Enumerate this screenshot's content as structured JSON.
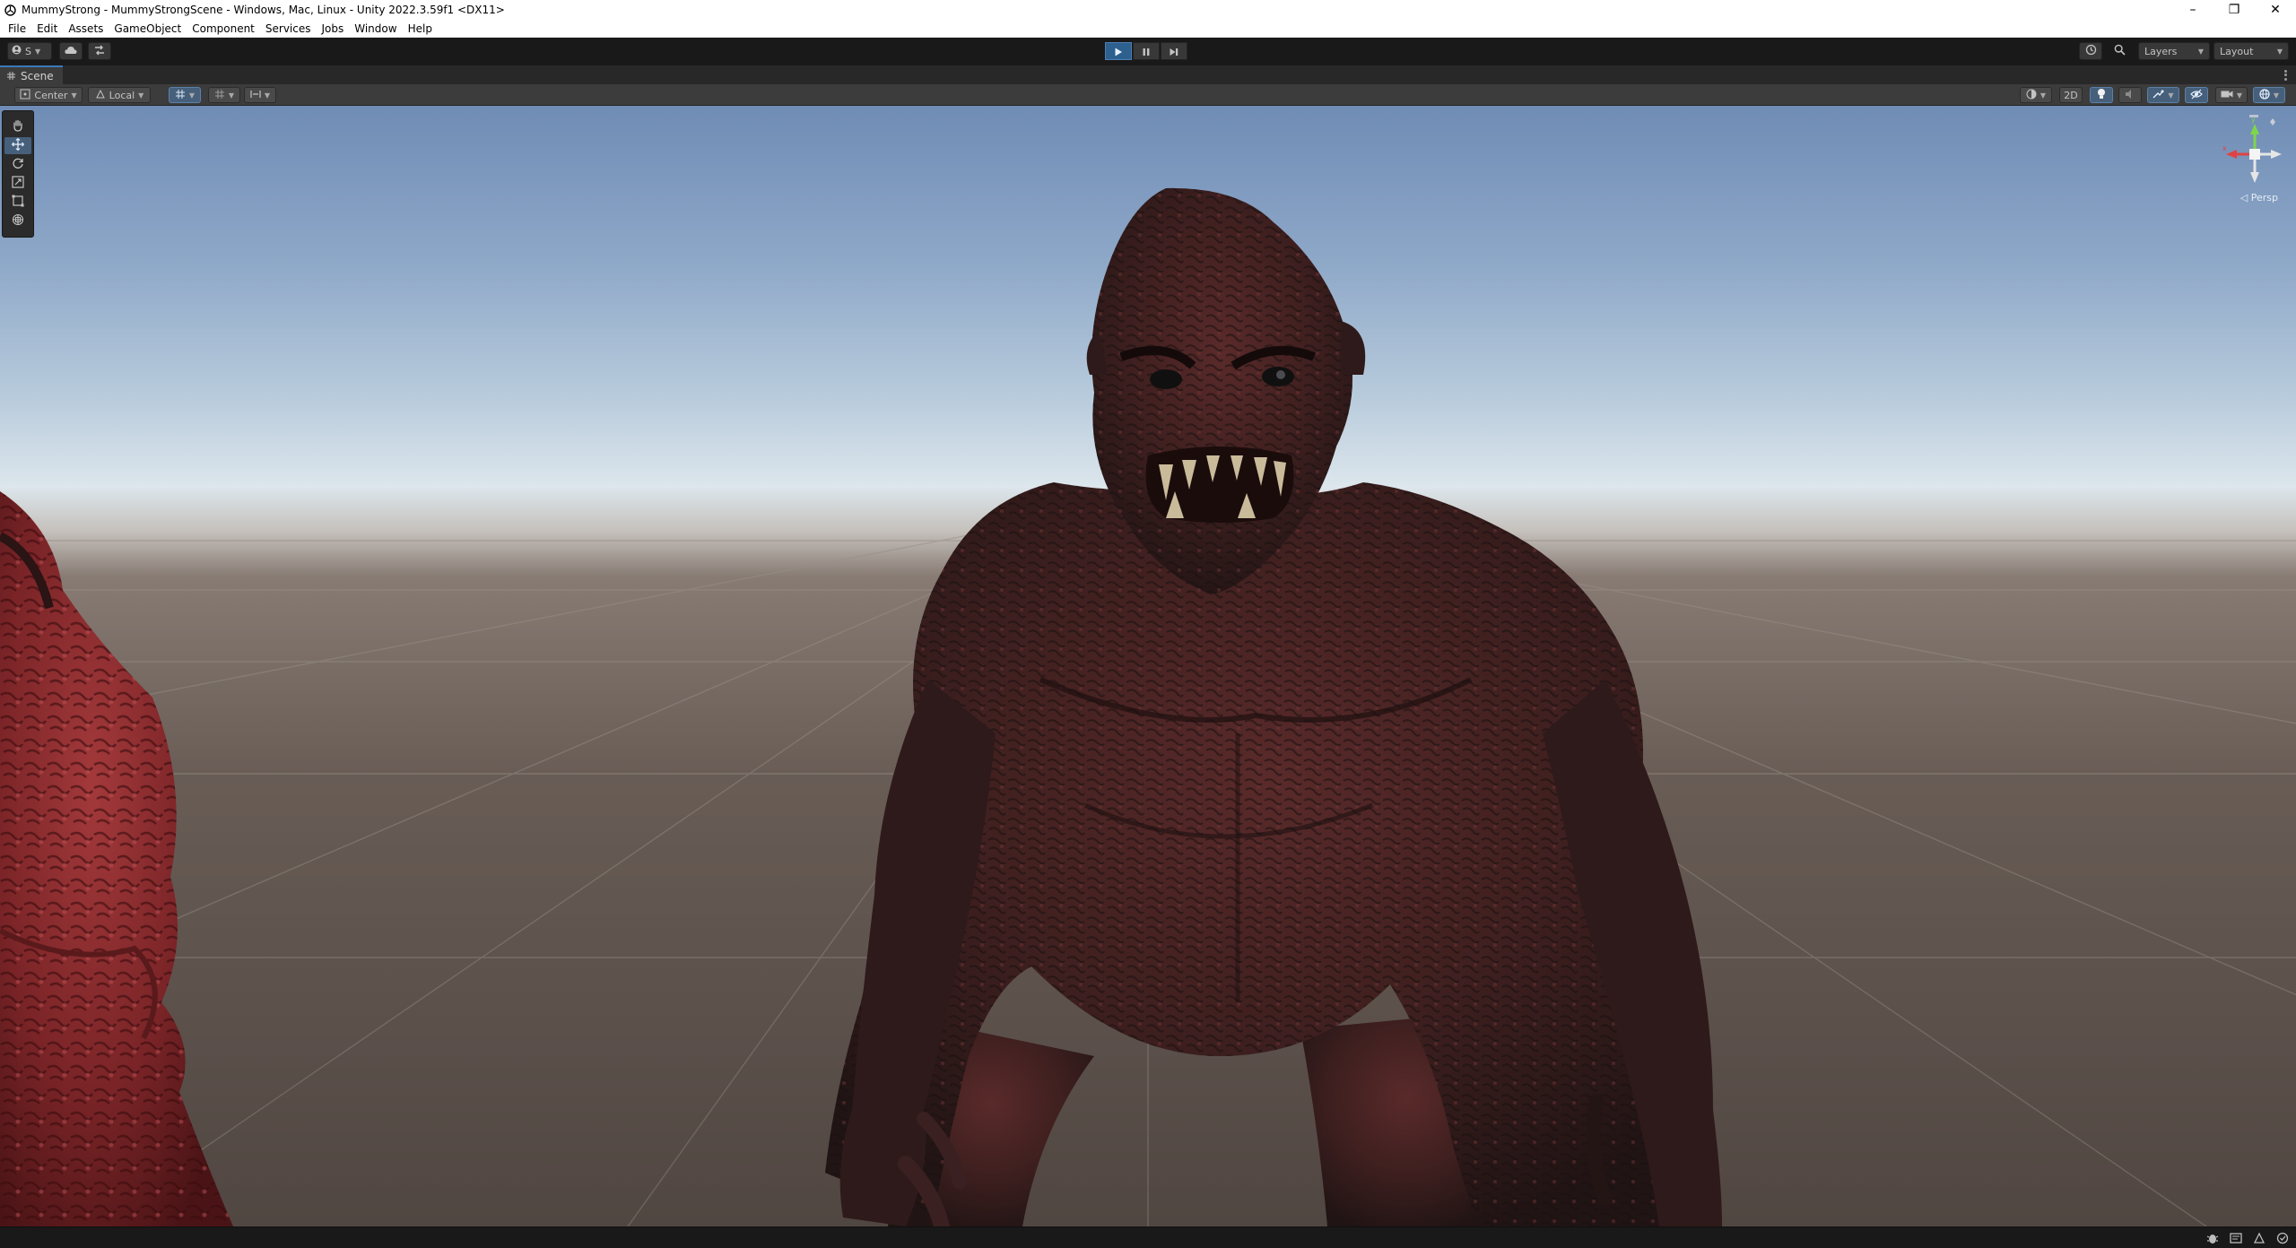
{
  "window": {
    "title": "MummyStrong - MummyStrongScene - Windows, Mac, Linux - Unity 2022.3.59f1 <DX11>",
    "minimize_glyph": "–",
    "restore_glyph": "❐",
    "close_glyph": "✕"
  },
  "menu": [
    "File",
    "Edit",
    "Assets",
    "GameObject",
    "Component",
    "Services",
    "Jobs",
    "Window",
    "Help"
  ],
  "toolbar": {
    "account_label": "S",
    "layers_label": "Layers",
    "layout_label": "Layout",
    "play_active": true
  },
  "scene_tab": {
    "label": "Scene",
    "icon": "hash-icon"
  },
  "scene_toolbar": {
    "pivot_label": "Center",
    "rotation_label": "Local",
    "mode_2d_label": "2D"
  },
  "viewport": {
    "projection_label": "◁ Persp",
    "active_tool": "move"
  },
  "colors": {
    "play_active": "#2d5f8f",
    "toggle_on": "#46607c",
    "gizmo_x": "#e04343",
    "gizmo_y": "#7fd64a",
    "gizmo_z": "#4a8de0"
  }
}
